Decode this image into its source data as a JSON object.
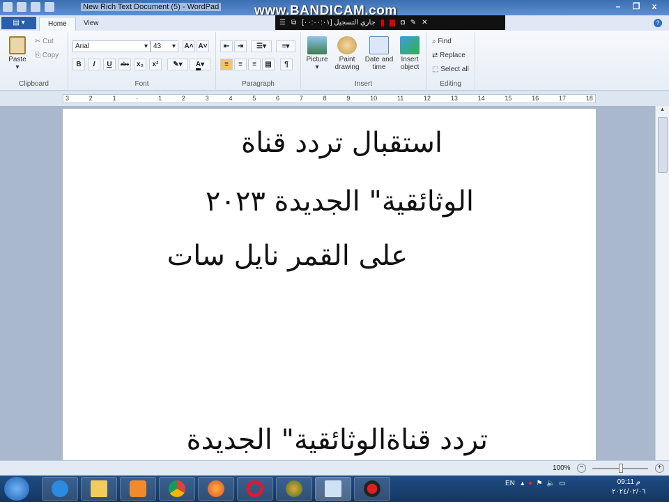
{
  "window": {
    "title": "New Rich Text Document (5) - WordPad",
    "minimize": "–",
    "maximize": "❐",
    "close": "x"
  },
  "overlay": {
    "watermark": "www.BANDICAM.com",
    "recording_label": "جاري التسجيل [٠٠:٠٠:٠١]"
  },
  "tabs": {
    "file": "▤ ▾",
    "home": "Home",
    "view": "View",
    "help": "?"
  },
  "ribbon": {
    "clipboard": {
      "label": "Clipboard",
      "paste": "Paste",
      "cut": "Cut",
      "copy": "Copy"
    },
    "font": {
      "label": "Font",
      "family": "Arial",
      "size": "43",
      "grow": "A˄",
      "shrink": "A˅",
      "bold": "B",
      "italic": "I",
      "underline": "U",
      "strike": "abc",
      "subscript": "x₂",
      "superscript": "x²",
      "highlight": "✎",
      "color": "A"
    },
    "paragraph": {
      "label": "Paragraph"
    },
    "insert": {
      "label": "Insert",
      "picture": "Picture",
      "paint": "Paint drawing",
      "datetime": "Date and time",
      "object": "Insert object"
    },
    "editing": {
      "label": "Editing",
      "find": "Find",
      "replace": "Replace",
      "select_all": "Select all"
    }
  },
  "ruler": [
    "3",
    "2",
    "1",
    "·",
    "1",
    "2",
    "3",
    "4",
    "5",
    "6",
    "7",
    "8",
    "9",
    "10",
    "11",
    "12",
    "13",
    "14",
    "15",
    "16",
    "17",
    "18"
  ],
  "document": {
    "lines": [
      "استقبال تردد قناة",
      "الوثائقية\" الجديدة ٢٠٢٣",
      "على القمر نايل سات",
      "تردد قناةالوثائقية\" الجديدة"
    ]
  },
  "status": {
    "zoom": "100%",
    "zoom_out": "−",
    "zoom_in": "+"
  },
  "taskbar": {
    "lang": "EN",
    "time": "09:11 م",
    "date": "٢٠٢٤/٠٢/٠٦"
  },
  "colors": {
    "titlebar": "#3b6fb2",
    "taskbar": "#1f4d86",
    "accent": "#f5c46a"
  }
}
